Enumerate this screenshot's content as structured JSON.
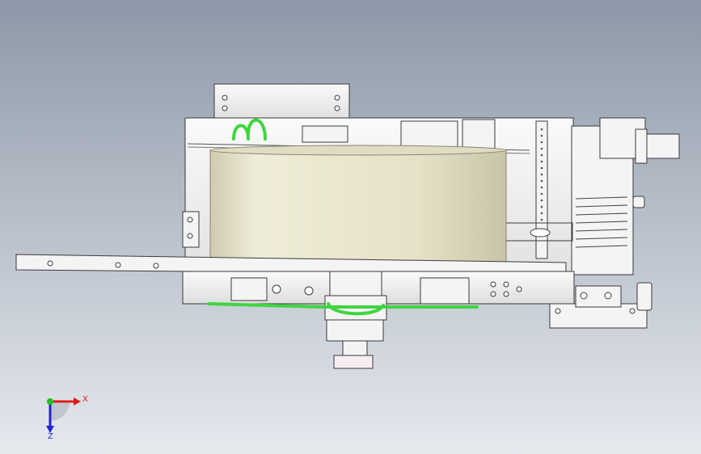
{
  "viewport": {
    "background_top": "#8d98a8",
    "background_bottom": "#e6e9ee"
  },
  "model": {
    "drum_color": "#e9e5cf",
    "hose_color": "#3fd53f",
    "outline_color": "#3a3a3a",
    "part_color": "#f4f4f4"
  },
  "triad": {
    "x_label": "X",
    "z_label": "Z",
    "x_color": "#e21b1b",
    "y_color": "#1fbf1f",
    "z_color": "#2424cf"
  }
}
